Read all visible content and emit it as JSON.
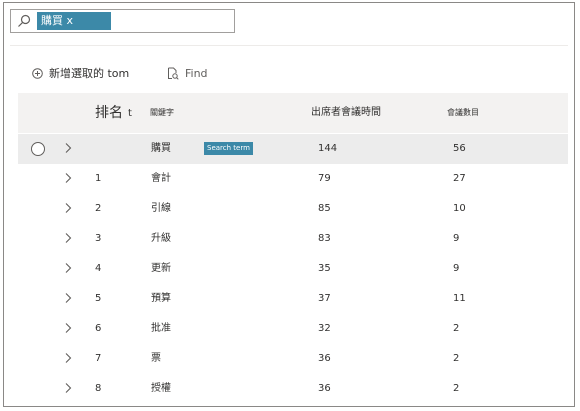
{
  "search": {
    "chip_text": "購買 x",
    "icon": "search-icon"
  },
  "toolbar": {
    "add_label": "新增選取的 tom",
    "add_icon": "add-circle-icon",
    "find_label": "Find",
    "find_icon": "find-document-icon"
  },
  "table": {
    "headers": {
      "rank": "排名",
      "rank_sort": "t",
      "keyword": "關鍵字",
      "attendee_time": "出席者會議時間",
      "meeting_count": "會議數目"
    },
    "search_term_badge": "Search term",
    "rows": [
      {
        "rank": "",
        "keyword": "購買",
        "attendee_time": "144",
        "meeting_count": "56"
      },
      {
        "rank": "1",
        "keyword": "會計",
        "attendee_time": "79",
        "meeting_count": "27"
      },
      {
        "rank": "2",
        "keyword": "引線",
        "attendee_time": "85",
        "meeting_count": "10"
      },
      {
        "rank": "3",
        "keyword": "升級",
        "attendee_time": "83",
        "meeting_count": "9"
      },
      {
        "rank": "4",
        "keyword": "更新",
        "attendee_time": "35",
        "meeting_count": "9"
      },
      {
        "rank": "5",
        "keyword": "預算",
        "attendee_time": "37",
        "meeting_count": "11"
      },
      {
        "rank": "6",
        "keyword": "批准",
        "attendee_time": "32",
        "meeting_count": "2"
      },
      {
        "rank": "7",
        "keyword": "票",
        "attendee_time": "36",
        "meeting_count": "2"
      },
      {
        "rank": "8",
        "keyword": "授權",
        "attendee_time": "36",
        "meeting_count": "2"
      }
    ]
  },
  "colors": {
    "accent": "#3c89a8",
    "header_bg": "#f3f2f1",
    "selected_row_bg": "#ececec"
  }
}
